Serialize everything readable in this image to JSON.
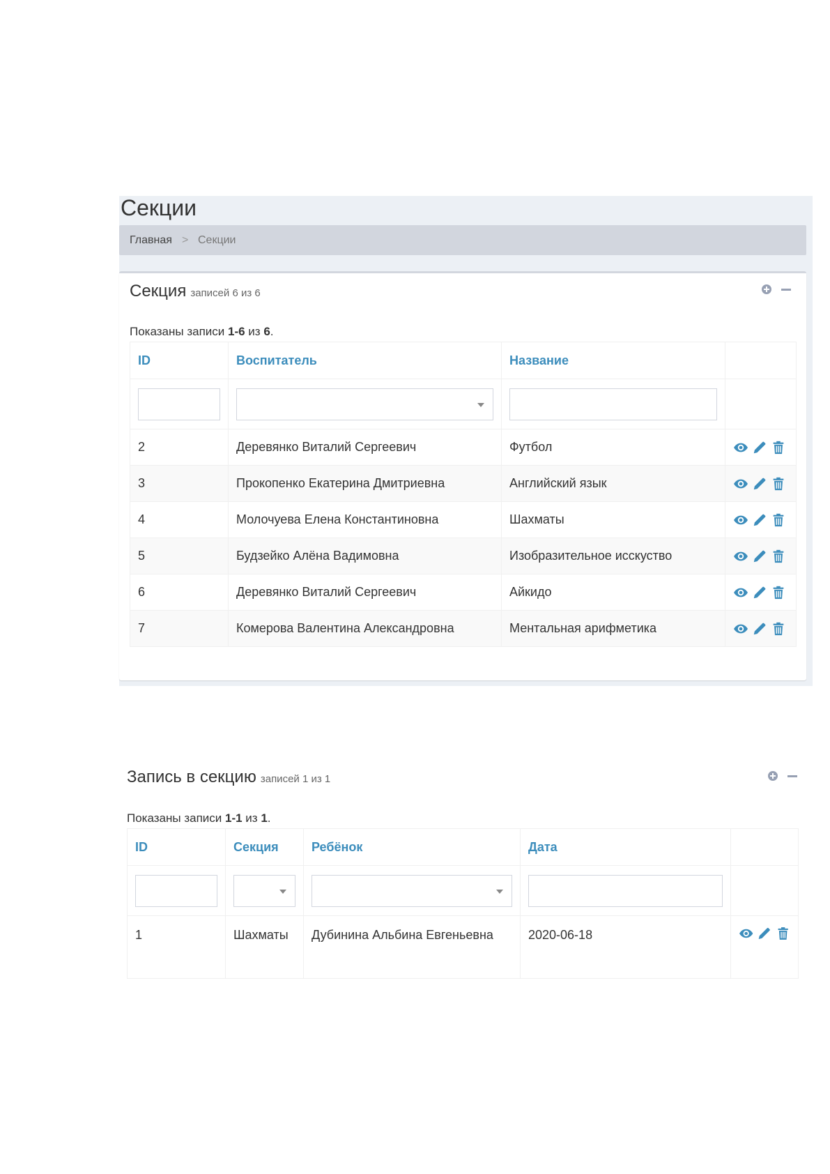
{
  "page": {
    "title": "Секции",
    "breadcrumb": {
      "home": "Главная",
      "separator": ">",
      "current": "Секции"
    }
  },
  "sections_box": {
    "title": "Секция",
    "subtitle": "записей 6 из 6",
    "summary_prefix": "Показаны записи ",
    "summary_range": "1-6",
    "summary_mid": " из ",
    "summary_total": "6",
    "summary_suffix": ".",
    "columns": {
      "id": "ID",
      "teacher": "Воспитатель",
      "name": "Название"
    },
    "rows": [
      {
        "id": "2",
        "teacher": "Деревянко Виталий Сергеевич",
        "name": "Футбол"
      },
      {
        "id": "3",
        "teacher": "Прокопенко Екатерина Дмитриевна",
        "name": "Английский язык"
      },
      {
        "id": "4",
        "teacher": "Молочуева Елена Константиновна",
        "name": "Шахматы"
      },
      {
        "id": "5",
        "teacher": "Будзейко Алёна Вадимовна",
        "name": "Изобразительное исскуство"
      },
      {
        "id": "6",
        "teacher": "Деревянко Виталий Сергеевич",
        "name": "Айкидо"
      },
      {
        "id": "7",
        "teacher": "Комерова Валентина Александровна",
        "name": "Ментальная арифметика"
      }
    ]
  },
  "enroll_box": {
    "title": "Запись в секцию",
    "subtitle": "записей 1 из 1",
    "summary_prefix": "Показаны записи ",
    "summary_range": "1-1",
    "summary_mid": " из ",
    "summary_total": "1",
    "summary_suffix": ".",
    "columns": {
      "id": "ID",
      "section": "Секция",
      "child": "Ребёнок",
      "date": "Дата"
    },
    "rows": [
      {
        "id": "1",
        "section": "Шахматы",
        "child": "Дубинина Альбина Евгеньевна",
        "date": "2020-06-18"
      }
    ]
  },
  "colors": {
    "link": "#3c8dbc",
    "icon": "#3c8dbc",
    "breadcrumb_bg": "#d2d6de",
    "panel_bg": "#ecf0f5"
  },
  "icons": {
    "view": "eye-icon",
    "edit": "pencil-icon",
    "delete": "trash-icon",
    "expand": "plus-circle-icon",
    "collapse": "minus-icon"
  }
}
